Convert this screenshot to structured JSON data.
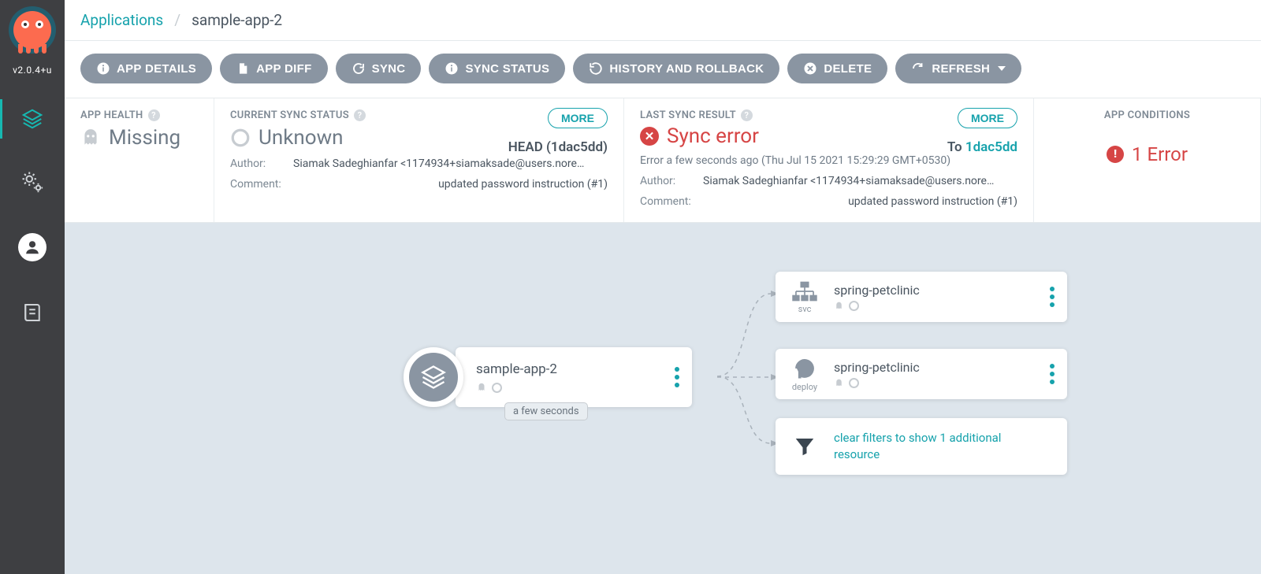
{
  "sidebar": {
    "version": "v2.0.4+u"
  },
  "breadcrumb": {
    "root": "Applications",
    "sep": "/",
    "current": "sample-app-2"
  },
  "toolbar": {
    "app_details": "APP DETAILS",
    "app_diff": "APP DIFF",
    "sync": "SYNC",
    "sync_status": "SYNC STATUS",
    "history": "HISTORY AND ROLLBACK",
    "delete": "DELETE",
    "refresh": "REFRESH"
  },
  "health": {
    "title": "APP HEALTH",
    "value": "Missing"
  },
  "sync_status": {
    "title": "CURRENT SYNC STATUS",
    "value": "Unknown",
    "head_rev": "HEAD (1dac5dd)",
    "author_label": "Author:",
    "author": "Siamak Sadeghianfar <1174934+siamaksade@users.nore…",
    "comment_label": "Comment:",
    "comment": "updated password instruction (#1)",
    "more": "MORE"
  },
  "last_sync": {
    "title": "LAST SYNC RESULT",
    "status": "Sync error",
    "to_label": "To",
    "to_rev": "1dac5dd",
    "timestamp": "Error a few seconds ago (Thu Jul 15 2021 15:29:29 GMT+0530)",
    "author_label": "Author:",
    "author": "Siamak Sadeghianfar <1174934+siamaksade@users.nore…",
    "comment_label": "Comment:",
    "comment": "updated password instruction (#1)",
    "more": "MORE"
  },
  "conditions": {
    "title": "APP CONDITIONS",
    "error_count": "1 Error"
  },
  "tree": {
    "root": {
      "name": "sample-app-2",
      "chip": "a few seconds"
    },
    "children": {
      "svc": {
        "kind": "svc",
        "name": "spring-petclinic"
      },
      "deploy": {
        "kind": "deploy",
        "name": "spring-petclinic"
      },
      "clear_filters": "clear filters to show 1 additional resource"
    }
  }
}
